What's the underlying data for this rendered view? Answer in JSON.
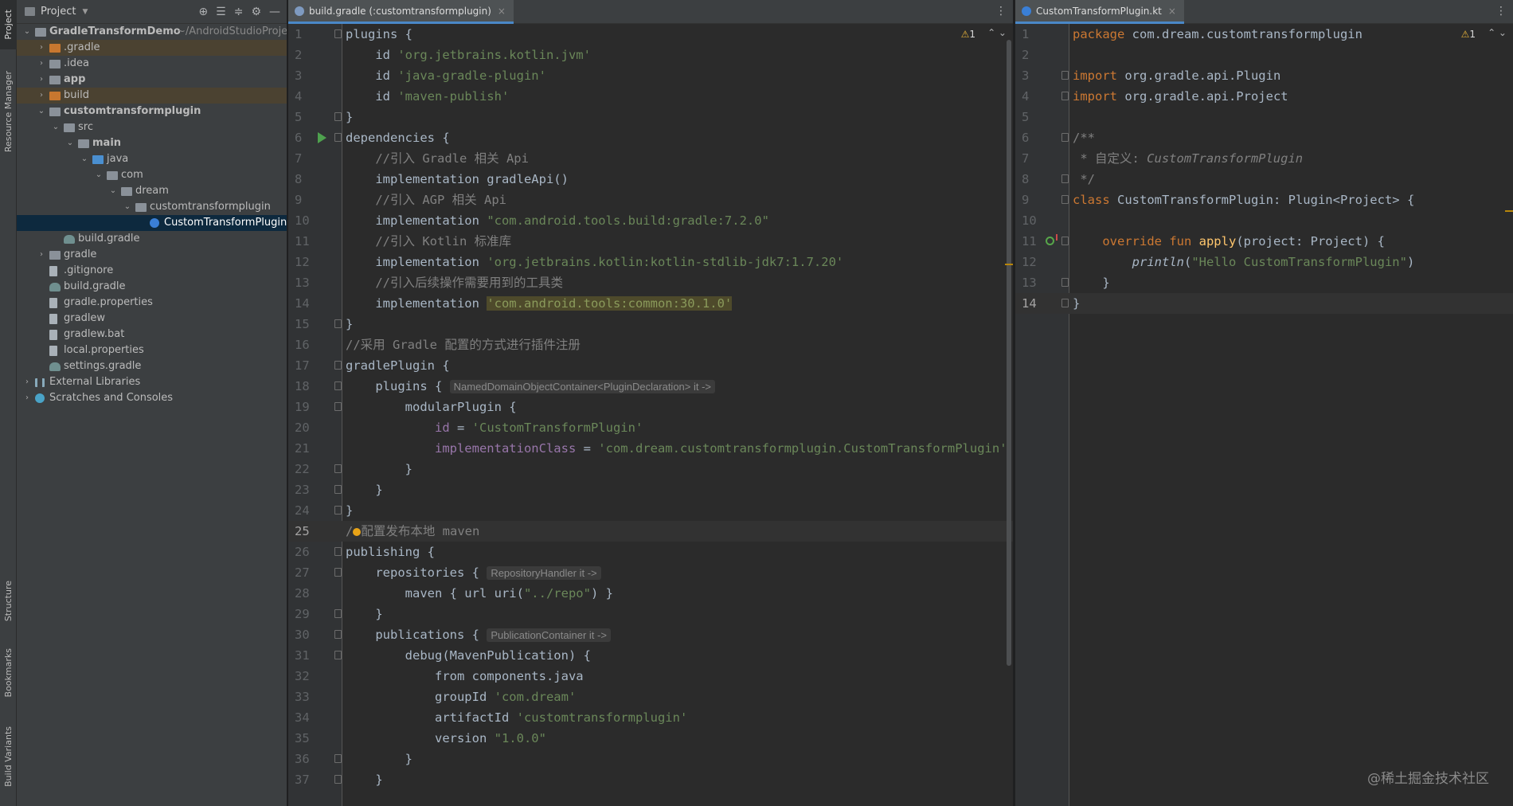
{
  "left_strip": {
    "tabs": [
      "Project",
      "Resource Manager",
      "Structure",
      "Bookmarks",
      "Build Variants"
    ]
  },
  "project_panel": {
    "title": "Project",
    "tree": [
      {
        "label": "GradleTransformDemo",
        "suffix": "~/AndroidStudioProject",
        "indent": 0,
        "arrow": "expanded",
        "icon": "folder",
        "bold": true
      },
      {
        "label": ".gradle",
        "indent": 1,
        "arrow": "collapsed",
        "icon": "orange",
        "highlight": true
      },
      {
        "label": ".idea",
        "indent": 1,
        "arrow": "collapsed",
        "icon": "folder"
      },
      {
        "label": "app",
        "indent": 1,
        "arrow": "collapsed",
        "icon": "folder",
        "bold": true
      },
      {
        "label": "build",
        "indent": 1,
        "arrow": "collapsed",
        "icon": "orange",
        "highlight": true
      },
      {
        "label": "customtransformplugin",
        "indent": 1,
        "arrow": "expanded",
        "icon": "folder",
        "bold": true
      },
      {
        "label": "src",
        "indent": 2,
        "arrow": "expanded",
        "icon": "folder"
      },
      {
        "label": "main",
        "indent": 3,
        "arrow": "expanded",
        "icon": "folder",
        "bold": true
      },
      {
        "label": "java",
        "indent": 4,
        "arrow": "expanded",
        "icon": "blue"
      },
      {
        "label": "com",
        "indent": 5,
        "arrow": "expanded",
        "icon": "folder"
      },
      {
        "label": "dream",
        "indent": 6,
        "arrow": "expanded",
        "icon": "folder"
      },
      {
        "label": "customtransformplugin",
        "indent": 7,
        "arrow": "expanded",
        "icon": "folder"
      },
      {
        "label": "CustomTransformPlugin",
        "indent": 8,
        "arrow": "none",
        "icon": "kt",
        "selected": true
      },
      {
        "label": "build.gradle",
        "indent": 2,
        "arrow": "none",
        "icon": "gradle"
      },
      {
        "label": "gradle",
        "indent": 1,
        "arrow": "collapsed",
        "icon": "folder"
      },
      {
        "label": ".gitignore",
        "indent": 1,
        "arrow": "none",
        "icon": "file"
      },
      {
        "label": "build.gradle",
        "indent": 1,
        "arrow": "none",
        "icon": "gradle"
      },
      {
        "label": "gradle.properties",
        "indent": 1,
        "arrow": "none",
        "icon": "file"
      },
      {
        "label": "gradlew",
        "indent": 1,
        "arrow": "none",
        "icon": "file"
      },
      {
        "label": "gradlew.bat",
        "indent": 1,
        "arrow": "none",
        "icon": "file"
      },
      {
        "label": "local.properties",
        "indent": 1,
        "arrow": "none",
        "icon": "file"
      },
      {
        "label": "settings.gradle",
        "indent": 1,
        "arrow": "none",
        "icon": "gradle"
      },
      {
        "label": "External Libraries",
        "indent": 0,
        "arrow": "collapsed",
        "icon": "lib"
      },
      {
        "label": "Scratches and Consoles",
        "indent": 0,
        "arrow": "collapsed",
        "icon": "scratch"
      }
    ]
  },
  "editor_left": {
    "tab_label": "build.gradle (:customtransformplugin)",
    "warning_count": "1",
    "current_line": 25,
    "lines": [
      {
        "n": "1",
        "fold": true,
        "parts": [
          [
            "plain",
            "plugins {"
          ]
        ]
      },
      {
        "n": "2",
        "parts": [
          [
            "plain",
            "    id "
          ],
          [
            "str",
            "'org.jetbrains.kotlin.jvm'"
          ]
        ]
      },
      {
        "n": "3",
        "parts": [
          [
            "plain",
            "    id "
          ],
          [
            "str",
            "'java-gradle-plugin'"
          ]
        ]
      },
      {
        "n": "4",
        "parts": [
          [
            "plain",
            "    id "
          ],
          [
            "str",
            "'maven-publish'"
          ]
        ]
      },
      {
        "n": "5",
        "fold": true,
        "parts": [
          [
            "plain",
            "}"
          ]
        ]
      },
      {
        "n": "6",
        "fold": true,
        "run": true,
        "parts": [
          [
            "plain",
            "dependencies {"
          ]
        ]
      },
      {
        "n": "7",
        "parts": [
          [
            "cmt",
            "    //引入 Gradle 相关 Api"
          ]
        ]
      },
      {
        "n": "8",
        "parts": [
          [
            "plain",
            "    implementation gradleApi()"
          ]
        ]
      },
      {
        "n": "9",
        "parts": [
          [
            "cmt",
            "    //引入 AGP 相关 Api"
          ]
        ]
      },
      {
        "n": "10",
        "parts": [
          [
            "plain",
            "    implementation "
          ],
          [
            "str",
            "\"com.android.tools.build:gradle:7.2.0\""
          ]
        ]
      },
      {
        "n": "11",
        "parts": [
          [
            "cmt",
            "    //引入 Kotlin 标准库"
          ]
        ]
      },
      {
        "n": "12",
        "parts": [
          [
            "plain",
            "    implementation "
          ],
          [
            "str",
            "'org.jetbrains.kotlin:kotlin-stdlib-jdk7:1.7.20'"
          ]
        ]
      },
      {
        "n": "13",
        "parts": [
          [
            "cmt",
            "    //引入后续操作需要用到的工具类"
          ]
        ]
      },
      {
        "n": "14",
        "parts": [
          [
            "plain",
            "    implementation "
          ],
          [
            "hlstr",
            "'com.android.tools:common:30.1.0'"
          ]
        ]
      },
      {
        "n": "15",
        "fold": true,
        "parts": [
          [
            "plain",
            "}"
          ]
        ]
      },
      {
        "n": "16",
        "parts": [
          [
            "cmt",
            "//采用 Gradle 配置的方式进行插件注册"
          ]
        ]
      },
      {
        "n": "17",
        "fold": true,
        "parts": [
          [
            "plain",
            "gradlePlugin {"
          ]
        ]
      },
      {
        "n": "18",
        "fold": true,
        "parts": [
          [
            "plain",
            "    plugins { "
          ],
          [
            "hint",
            "NamedDomainObjectContainer<PluginDeclaration> it ->"
          ]
        ]
      },
      {
        "n": "19",
        "fold": true,
        "parts": [
          [
            "plain",
            "        modularPlugin {"
          ]
        ]
      },
      {
        "n": "20",
        "parts": [
          [
            "prop",
            "            id"
          ],
          [
            "plain",
            " = "
          ],
          [
            "str",
            "'CustomTransformPlugin'"
          ]
        ]
      },
      {
        "n": "21",
        "parts": [
          [
            "prop",
            "            implementationClass"
          ],
          [
            "plain",
            " = "
          ],
          [
            "str",
            "'com.dream.customtransformplugin.CustomTransformPlugin'"
          ]
        ]
      },
      {
        "n": "22",
        "fold": true,
        "parts": [
          [
            "plain",
            "        }"
          ]
        ]
      },
      {
        "n": "23",
        "fold": true,
        "parts": [
          [
            "plain",
            "    }"
          ]
        ]
      },
      {
        "n": "24",
        "fold": true,
        "parts": [
          [
            "plain",
            "}"
          ]
        ]
      },
      {
        "n": "25",
        "bulb": true,
        "parts": [
          [
            "cmt",
            "/"
          ],
          [
            "bulb",
            ""
          ],
          [
            "cmt",
            "配置发布本地 maven"
          ]
        ]
      },
      {
        "n": "26",
        "fold": true,
        "parts": [
          [
            "plain",
            "publishing {"
          ]
        ]
      },
      {
        "n": "27",
        "fold": true,
        "parts": [
          [
            "plain",
            "    repositories { "
          ],
          [
            "hint",
            "RepositoryHandler it ->"
          ]
        ]
      },
      {
        "n": "28",
        "parts": [
          [
            "plain",
            "        maven { url uri("
          ],
          [
            "str",
            "\"../repo\""
          ],
          [
            "plain",
            ") }"
          ]
        ]
      },
      {
        "n": "29",
        "fold": true,
        "parts": [
          [
            "plain",
            "    }"
          ]
        ]
      },
      {
        "n": "30",
        "fold": true,
        "parts": [
          [
            "plain",
            "    publications { "
          ],
          [
            "hint",
            "PublicationContainer it ->"
          ]
        ]
      },
      {
        "n": "31",
        "fold": true,
        "parts": [
          [
            "plain",
            "        debug(MavenPublication) {"
          ]
        ]
      },
      {
        "n": "32",
        "parts": [
          [
            "plain",
            "            from components.java"
          ]
        ]
      },
      {
        "n": "33",
        "parts": [
          [
            "plain",
            "            groupId "
          ],
          [
            "str",
            "'com.dream'"
          ]
        ]
      },
      {
        "n": "34",
        "parts": [
          [
            "plain",
            "            artifactId "
          ],
          [
            "str",
            "'customtransformplugin'"
          ]
        ]
      },
      {
        "n": "35",
        "parts": [
          [
            "plain",
            "            version "
          ],
          [
            "str",
            "\"1.0.0\""
          ]
        ]
      },
      {
        "n": "36",
        "fold": true,
        "parts": [
          [
            "plain",
            "        }"
          ]
        ]
      },
      {
        "n": "37",
        "fold": true,
        "parts": [
          [
            "plain",
            "    }"
          ]
        ]
      }
    ]
  },
  "editor_right": {
    "tab_label": "CustomTransformPlugin.kt",
    "warning_count": "1",
    "current_line": 14,
    "lines": [
      {
        "n": "1",
        "parts": [
          [
            "kw",
            "package "
          ],
          [
            "plain",
            "com.dream.customtransformplugin"
          ]
        ]
      },
      {
        "n": "2",
        "parts": [
          [
            "plain",
            ""
          ]
        ]
      },
      {
        "n": "3",
        "fold": true,
        "parts": [
          [
            "kw",
            "import "
          ],
          [
            "plain",
            "org.gradle.api.Plugin"
          ]
        ]
      },
      {
        "n": "4",
        "fold": true,
        "parts": [
          [
            "kw",
            "import "
          ],
          [
            "plain",
            "org.gradle.api.Project"
          ]
        ]
      },
      {
        "n": "5",
        "parts": [
          [
            "plain",
            ""
          ]
        ]
      },
      {
        "n": "6",
        "fold": true,
        "parts": [
          [
            "cmt",
            "/**"
          ]
        ]
      },
      {
        "n": "7",
        "parts": [
          [
            "cmt",
            " * 自定义: "
          ],
          [
            "cmtital",
            "CustomTransformPlugin"
          ]
        ]
      },
      {
        "n": "8",
        "fold": true,
        "parts": [
          [
            "cmt",
            " */"
          ]
        ]
      },
      {
        "n": "9",
        "fold": true,
        "parts": [
          [
            "kw",
            "class "
          ],
          [
            "plain",
            "CustomTransformPlugin: Plugin<Project> {"
          ]
        ]
      },
      {
        "n": "10",
        "parts": [
          [
            "plain",
            ""
          ]
        ]
      },
      {
        "n": "11",
        "fold": true,
        "override": true,
        "parts": [
          [
            "kw",
            "    override fun "
          ],
          [
            "fn",
            "apply"
          ],
          [
            "plain",
            "(project: Project) {"
          ]
        ]
      },
      {
        "n": "12",
        "parts": [
          [
            "plain",
            "        "
          ],
          [
            "ital",
            "println"
          ],
          [
            "plain",
            "("
          ],
          [
            "str",
            "\"Hello CustomTransformPlugin\""
          ],
          [
            "plain",
            ")"
          ]
        ]
      },
      {
        "n": "13",
        "fold": true,
        "parts": [
          [
            "plain",
            "    }"
          ]
        ]
      },
      {
        "n": "14",
        "fold": true,
        "parts": [
          [
            "plain",
            "}"
          ]
        ]
      }
    ]
  },
  "watermark": "@稀土掘金技术社区"
}
